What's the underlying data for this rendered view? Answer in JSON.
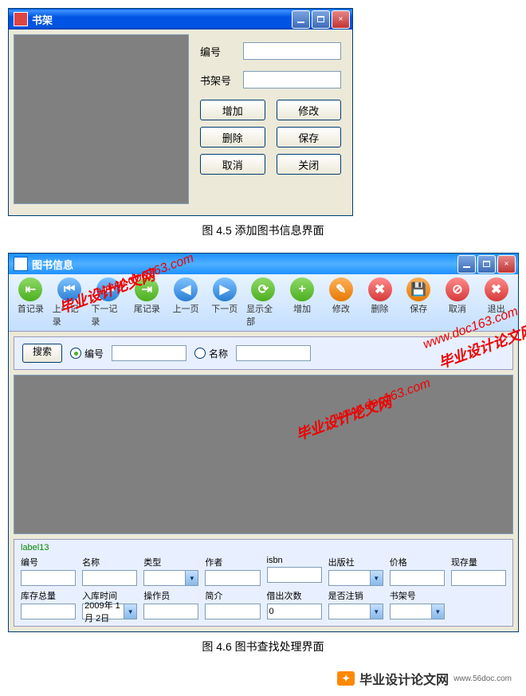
{
  "w1": {
    "title": "书架",
    "fields": {
      "id_label": "编号",
      "shelf_label": "书架号",
      "id_val": "",
      "shelf_val": ""
    },
    "buttons": {
      "add": "增加",
      "edit": "修改",
      "del": "删除",
      "save": "保存",
      "cancel": "取消",
      "close": "关闭"
    }
  },
  "cap1": "图 4.5 添加图书信息界面",
  "w2": {
    "title": "图书信息",
    "toolbar": {
      "first": "首记录",
      "prev_rec": "上一记录",
      "next_rec": "下一记录",
      "last": "尾记录",
      "prev_pg": "上一页",
      "next_pg": "下一页",
      "show_all": "显示全部",
      "add": "增加",
      "edit": "修改",
      "del": "删除",
      "save": "保存",
      "cancel": "取消",
      "exit": "退出"
    },
    "search": {
      "btn": "搜索",
      "by_id": "编号",
      "by_name": "名称",
      "id_val": "",
      "name_val": ""
    },
    "form_title": "label13",
    "form": {
      "id": "编号",
      "name": "名称",
      "type": "类型",
      "author": "作者",
      "isbn": "isbn",
      "pub": "出版社",
      "price": "价格",
      "stock": "现存量",
      "total": "库存总量",
      "indate": "入库时间",
      "indate_val": "2009年 1月 2日",
      "oper": "操作员",
      "intro": "简介",
      "borrow": "借出次数",
      "borrow_val": "0",
      "logout": "是否注销",
      "shelf": "书架号"
    }
  },
  "cap2": "图 4.6 图书查找处理界面",
  "watermark": {
    "txt1": "毕业设计论文网",
    "txt2": "www.doc163.com"
  },
  "footer": {
    "brand": "毕业设计论文网",
    "url": "www.56doc.com"
  }
}
